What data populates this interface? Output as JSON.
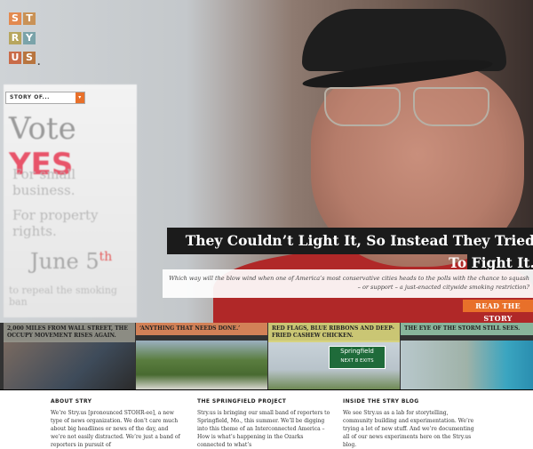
{
  "logo": {
    "letters": [
      "S",
      "T",
      "R",
      "Y",
      "U",
      "S"
    ],
    "dot": "."
  },
  "story_select": {
    "label": "STORY OF...",
    "arrow": "▾"
  },
  "hero": {
    "sign": {
      "vote": "Vote",
      "yes": "YES",
      "line1": "For small business.",
      "line2": "For property rights.",
      "date": "June 5",
      "date_suffix": "th",
      "line3": "to repeal the smoking ban"
    },
    "title": "They Couldn’t Light It, So Instead They Tried To Fight It.",
    "subtitle": "Which way will the blow wind when one of America’s most conservative cities heads to the polls with the chance to squash – or support – a just-enacted citywide smoking restriction?",
    "read_button": "READ THE STORY"
  },
  "tiles": [
    {
      "label": "2,000 miles from Wall Street, the Occupy movement rises again.",
      "color": "#9f9c90"
    },
    {
      "label": "‘Anything that needs done.’",
      "color": "#e0885a"
    },
    {
      "label": "Red flags, blue ribbons and deep-fried cashew chicken.",
      "color": "#d7d27a"
    },
    {
      "label": "The eye of the storm still sees.",
      "color": "#8fc0a4"
    }
  ],
  "tile_sign": {
    "city": "Springfield",
    "exits": "NEXT 8 EXITS"
  },
  "columns": [
    {
      "heading": "ABOUT STRY",
      "text": "We’re Stry.us [pronounced STOHR-ee], a new type of news organization. We don’t care much about big headlines or news of the day, and we’re not easily distracted. We’re just a band of reporters in pursuit of"
    },
    {
      "heading": "THE SPRINGFIELD PROJECT",
      "text": "Stry.us is bringing our small band of reporters to Springfield, Mo., this summer. We’ll be digging into this theme of an Interconnected America – How is what’s happening in the Ozarks connected to what’s"
    },
    {
      "heading": "INSIDE THE STRY BLOG",
      "text": "We see Stry.us as a lab for storytelling, community building and experimentation. We’re trying a lot of new stuff. And we’re documenting all of our news experiments here on the Stry.us blog."
    }
  ],
  "colors": {
    "accent": "#e8702a",
    "dark": "#1b1b1b"
  }
}
